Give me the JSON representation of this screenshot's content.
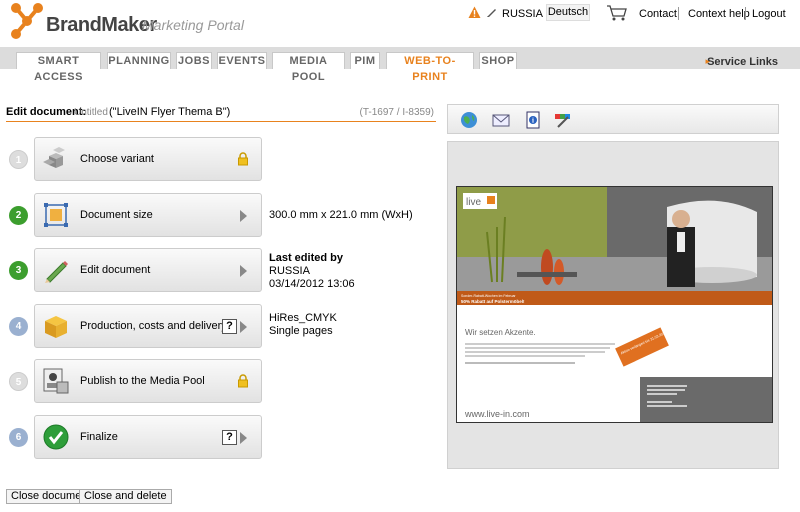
{
  "header": {
    "brand": "BrandMaker",
    "portal": "Marketing Portal",
    "user": "RUSSIA",
    "language": "Deutsch",
    "links": {
      "contact": "Contact",
      "context_help": "Context help",
      "logout": "Logout"
    }
  },
  "nav": {
    "tabs": [
      "SMART ACCESS",
      "PLANNING",
      "JOBS",
      "EVENTS",
      "MEDIA POOL",
      "PIM",
      "WEB-TO-PRINT",
      "SHOP"
    ],
    "active_tab": "WEB-TO-PRINT",
    "service_links": "Service Links"
  },
  "document": {
    "label": "Edit document:",
    "untitled": "Untitled",
    "name": "(\"LiveIN Flyer Thema B\")",
    "id": "(T-1697 / I-8359)"
  },
  "steps": [
    {
      "num": "1",
      "label": "Choose variant",
      "state": "disabled",
      "icon": "cubes-icon",
      "locked": true,
      "info": []
    },
    {
      "num": "2",
      "label": "Document size",
      "state": "done",
      "icon": "resize-icon",
      "info": [
        "300.0 mm x 221.0 mm (WxH)"
      ]
    },
    {
      "num": "3",
      "label": "Edit document",
      "state": "done",
      "icon": "pencil-icon",
      "info_bold": "Last edited by",
      "info": [
        "RUSSIA",
        "03/14/2012 13:06"
      ]
    },
    {
      "num": "4",
      "label": "Production, costs and delivery",
      "state": "pending",
      "icon": "package-icon",
      "help": true,
      "info": [
        "HiRes_CMYK",
        "Single pages"
      ]
    },
    {
      "num": "5",
      "label": "Publish to the Media Pool",
      "state": "disabled",
      "icon": "publish-icon",
      "locked": true,
      "info": []
    },
    {
      "num": "6",
      "label": "Finalize",
      "state": "pending",
      "icon": "checkmark-icon",
      "help": true,
      "info": []
    }
  ],
  "buttons": {
    "close": "Close document",
    "close_delete": "Close and delete"
  },
  "flyer": {
    "logo": "live",
    "banner_line1": "Sonder-Rabatt-Wochen im Februar",
    "banner_line2": "50% Rabatt auf Polstermöbel!",
    "headline": "Wir setzen Akzente.",
    "badge": "Aktion verlängert bis 31.03.2012",
    "url": "www.live-in.com"
  },
  "colors": {
    "accent": "#e8821e",
    "step_green": "#3c9e2e",
    "step_blue": "#9ab0d0"
  }
}
